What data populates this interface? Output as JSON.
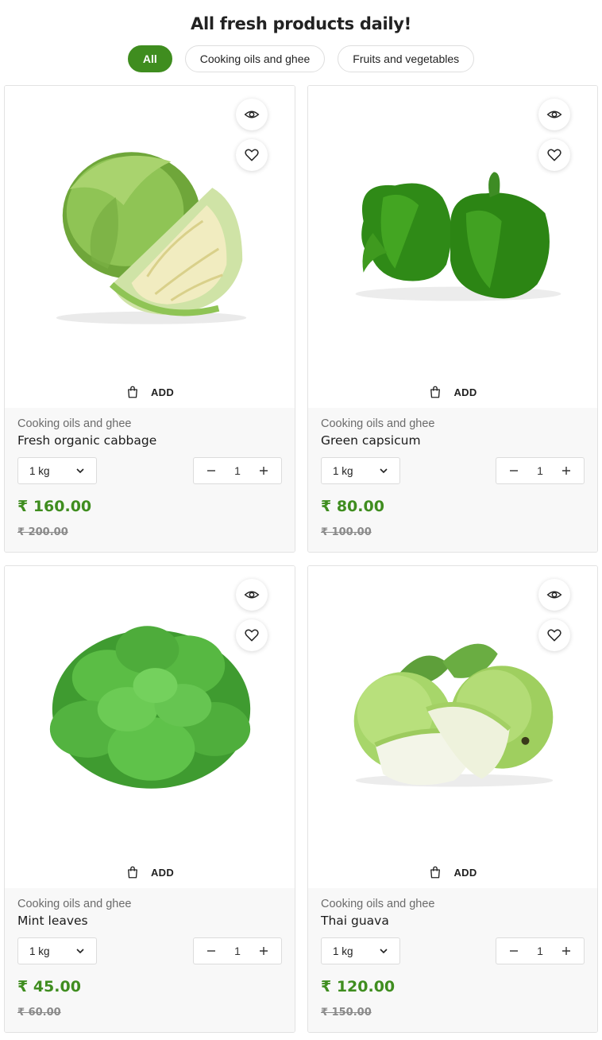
{
  "page": {
    "heading": "All fresh products daily!"
  },
  "filters": [
    {
      "label": "All",
      "active": true
    },
    {
      "label": "Cooking oils and ghee",
      "active": false
    },
    {
      "label": "Fruits and vegetables",
      "active": false
    }
  ],
  "colors": {
    "accent": "#3f8d1f",
    "info_bg": "#f8f8f8",
    "border": "#e2e2e2"
  },
  "icons": {
    "view": "eye-icon",
    "wishlist": "heart-icon",
    "cart": "shopping-bag-icon",
    "dropdown": "chevron-down-icon",
    "minus": "minus-icon",
    "plus": "plus-icon"
  },
  "products": [
    {
      "image": "cabbage",
      "add_label": "ADD",
      "category": "Cooking oils and ghee",
      "title": "Fresh organic cabbage",
      "unit": "1 kg",
      "quantity": "1",
      "price": "₹ 160.00",
      "old_price": "₹ 200.00"
    },
    {
      "image": "capsicum",
      "add_label": "ADD",
      "category": "Cooking oils and ghee",
      "title": "Green capsicum",
      "unit": "1 kg",
      "quantity": "1",
      "price": "₹ 80.00",
      "old_price": "₹ 100.00"
    },
    {
      "image": "mint",
      "add_label": "ADD",
      "category": "Cooking oils and ghee",
      "title": "Mint leaves",
      "unit": "1 kg",
      "quantity": "1",
      "price": "₹ 45.00",
      "old_price": "₹ 60.00"
    },
    {
      "image": "guava",
      "add_label": "ADD",
      "category": "Cooking oils and ghee",
      "title": "Thai guava",
      "unit": "1 kg",
      "quantity": "1",
      "price": "₹ 120.00",
      "old_price": "₹ 150.00"
    }
  ]
}
